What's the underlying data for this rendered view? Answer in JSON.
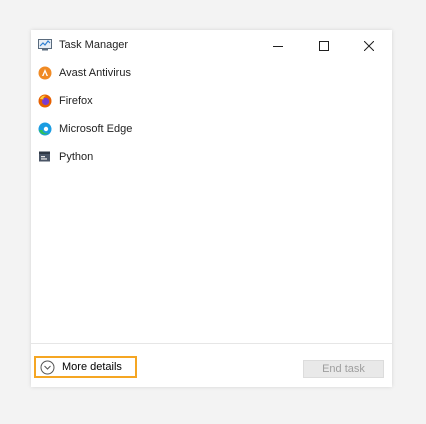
{
  "window": {
    "title": "Task Manager",
    "title_icon": "task-manager-icon",
    "controls": {
      "minimize_icon": "minimize-icon",
      "maximize_icon": "maximize-icon",
      "close_icon": "close-icon"
    }
  },
  "apps": [
    {
      "label": "Avast Antivirus",
      "icon": "avast-icon",
      "color": "#f08a24"
    },
    {
      "label": "Firefox",
      "icon": "firefox-icon",
      "color": "#e66000"
    },
    {
      "label": "Microsoft Edge",
      "icon": "edge-icon",
      "color": "#1b9de2"
    },
    {
      "label": "Python",
      "icon": "python-app-icon",
      "color": "#4a5566"
    }
  ],
  "footer": {
    "more_details_label": "More details",
    "more_details_icon": "chevron-down-icon",
    "highlight_color": "#f5a623",
    "end_task_label": "End task"
  }
}
